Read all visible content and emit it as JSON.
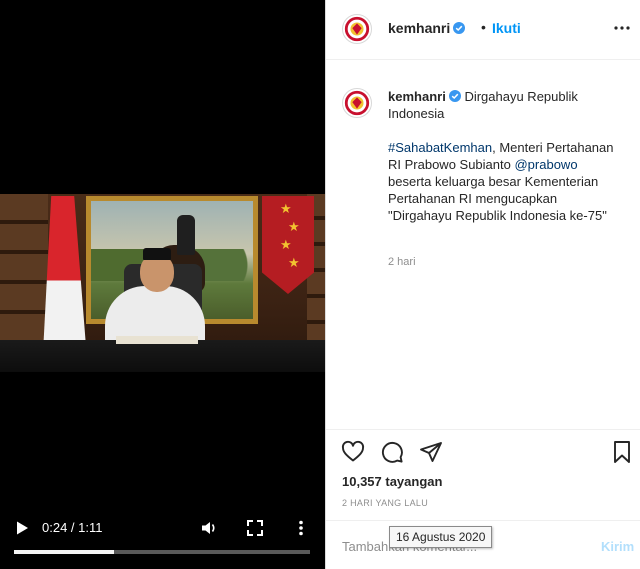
{
  "video": {
    "time_display": "0:24 / 1:11",
    "progress": 0.338,
    "icons": [
      "play-icon",
      "volume-icon",
      "fullscreen-icon",
      "more-vertical-icon"
    ]
  },
  "header": {
    "username": "kemhanri",
    "separator": "•",
    "follow_label": "Ikuti",
    "icons": [
      "avatar-logo-icon",
      "verified-badge-icon",
      "more-options-icon"
    ]
  },
  "caption": {
    "username": "kemhanri",
    "title": "Dirgahayu Republik Indonesia",
    "hashtag": "#SahabatKemhan",
    "text_1": ", Menteri Pertahanan RI Prabowo Subianto",
    "mention": "@prabowo",
    "text_2": "beserta keluarga besar Kementerian Pertahanan RI mengucapkan \"Dirgahayu Republik Indonesia ke-75\"",
    "age": "2 hari"
  },
  "actions": {
    "icons": [
      "heart-icon",
      "comment-icon",
      "share-icon",
      "bookmark-icon"
    ]
  },
  "stats": {
    "views": "10,357 tayangan",
    "date": "2 HARI YANG LALU",
    "date_tooltip": "16 Agustus 2020"
  },
  "comment": {
    "placeholder": "Tambahkan komentar...",
    "post_label": "Kirim"
  },
  "colors": {
    "link": "#0095f6",
    "tag": "#00376b",
    "muted": "#8e8e8e",
    "post_disabled": "#b2dffc",
    "verified": "#3897f0"
  }
}
